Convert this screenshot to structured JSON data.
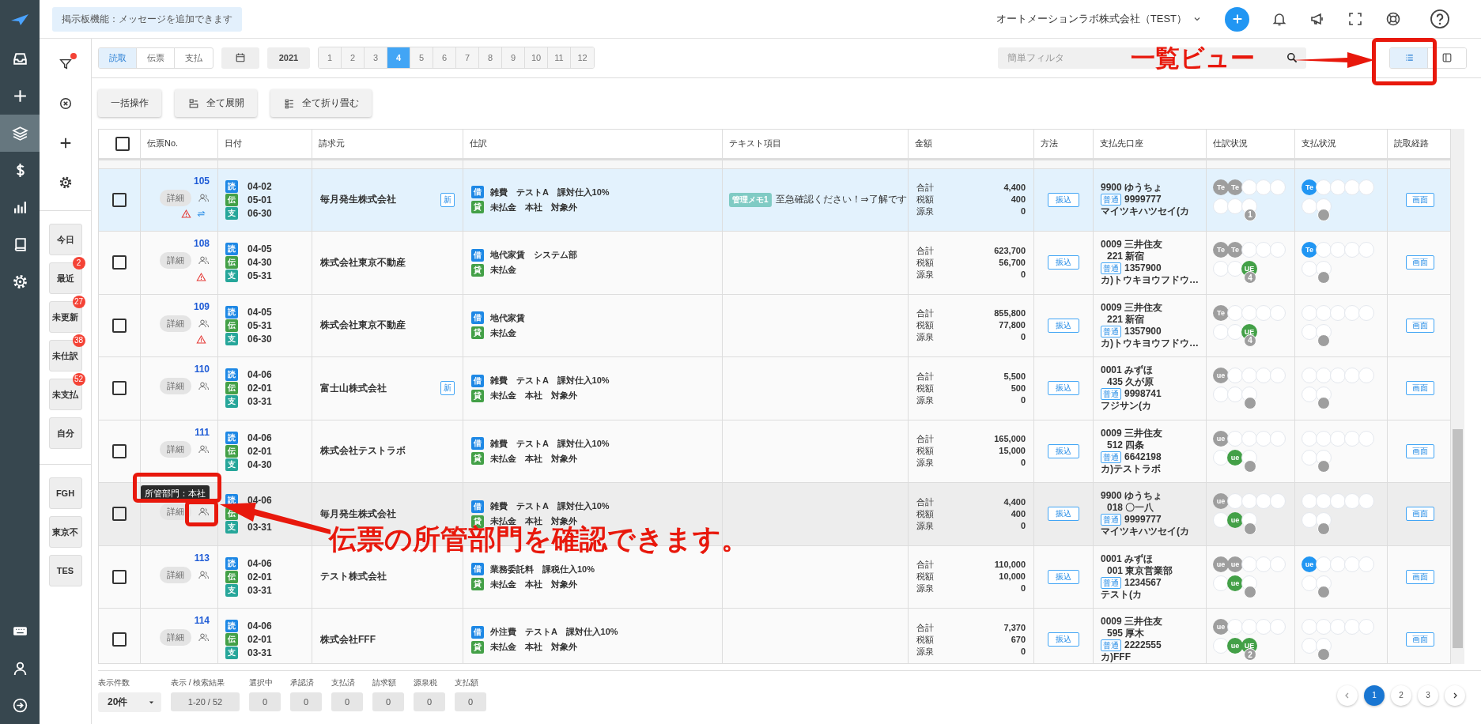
{
  "topbar": {
    "notice": "掲示板機能：メッセージを追加できます",
    "company": "オートメーションラボ株式会社（TEST）",
    "actions": [
      {
        "kind": "add"
      },
      {
        "kind": "bell"
      },
      {
        "kind": "megaphone"
      },
      {
        "kind": "fullscreen"
      },
      {
        "kind": "support"
      },
      {
        "kind": "help"
      }
    ]
  },
  "rail": {
    "items": [
      {
        "kind": "inbox",
        "selected": false
      },
      {
        "kind": "add",
        "selected": false
      },
      {
        "kind": "layers",
        "selected": true
      },
      {
        "kind": "dollar",
        "selected": false
      },
      {
        "kind": "chart",
        "selected": false
      },
      {
        "kind": "book",
        "selected": false
      },
      {
        "kind": "settings",
        "selected": false
      }
    ],
    "bottom": [
      {
        "kind": "keyboard"
      },
      {
        "kind": "person"
      },
      {
        "kind": "logout"
      }
    ]
  },
  "side_panel": {
    "tools": [
      {
        "kind": "filter",
        "alert": true
      },
      {
        "kind": "clear",
        "alert": false
      },
      {
        "kind": "add",
        "alert": false
      },
      {
        "kind": "settings",
        "alert": false
      }
    ],
    "quick_filters": [
      {
        "label": "今日"
      },
      {
        "label": "最近",
        "count": "2"
      },
      {
        "label": "未更新",
        "count": "27"
      },
      {
        "label": "未仕訳",
        "count": "38"
      },
      {
        "label": "未支払",
        "count": "52"
      },
      {
        "label": "自分"
      }
    ],
    "saved_filters": [
      {
        "label": "FGH"
      },
      {
        "label": "東京不"
      },
      {
        "label": "TES"
      }
    ]
  },
  "toolbar": {
    "modes": [
      {
        "label": "読取",
        "selected": true
      },
      {
        "label": "伝票",
        "selected": false
      },
      {
        "label": "支払",
        "selected": false
      }
    ],
    "year": "2021",
    "months": [
      {
        "label": "1",
        "selected": false
      },
      {
        "label": "2",
        "selected": false
      },
      {
        "label": "3",
        "selected": false
      },
      {
        "label": "4",
        "selected": true
      },
      {
        "label": "5",
        "selected": false
      },
      {
        "label": "6",
        "selected": false
      },
      {
        "label": "7",
        "selected": false
      },
      {
        "label": "8",
        "selected": false
      },
      {
        "label": "9",
        "selected": false
      },
      {
        "label": "10",
        "selected": false
      },
      {
        "label": "11",
        "selected": false
      },
      {
        "label": "12",
        "selected": false
      }
    ],
    "search": {
      "placeholder": "簡単フィルタ"
    },
    "views": [
      {
        "kind": "list",
        "selected": true
      },
      {
        "kind": "split",
        "selected": false
      }
    ]
  },
  "actions": [
    {
      "label": "一括操作",
      "kind": "plain"
    },
    {
      "label": "全て展開",
      "kind": "expand"
    },
    {
      "label": "全て折り畳む",
      "kind": "collapse"
    }
  ],
  "table": {
    "all_checked": false,
    "columns": [
      "伝票No.",
      "日付",
      "請求元",
      "仕訳",
      "テキスト項目",
      "金額",
      "方法",
      "支払先口座",
      "仕訳状況",
      "支払状況",
      "読取経路"
    ],
    "rows": [
      {
        "no": "105",
        "checked": false,
        "selected": true,
        "hovered": false,
        "detail": "詳細",
        "warning": true,
        "synced": true,
        "dates": [
          {
            "kind": "read",
            "label": "読",
            "date": "04-02"
          },
          {
            "kind": "slip",
            "label": "伝",
            "date": "05-01"
          },
          {
            "kind": "pay",
            "label": "支",
            "date": "06-30"
          }
        ],
        "vendor": "毎月発生株式会社",
        "new_badge": "新",
        "journal": [
          {
            "kind": "debit",
            "label": "借",
            "text": "雑費　テストA　課対仕入10%"
          },
          {
            "kind": "credit",
            "label": "貸",
            "text": "未払金　本社　対象外"
          }
        ],
        "memo": {
          "tag": "管理メモ1",
          "text": "至急確認ください！⇒了解です"
        },
        "amounts": [
          {
            "label": "合計",
            "value": "4,400"
          },
          {
            "label": "税額",
            "value": "400"
          },
          {
            "label": "源泉",
            "value": "0"
          }
        ],
        "method": "振込",
        "account": {
          "bank": "9900 ゆうちょ",
          "type": "普通",
          "number": "9999777",
          "holder": "マイツキハツセイ(カ"
        },
        "journal_status": {
          "top": [
            {
              "kind": "mark",
              "label": "Te",
              "color": "#9e9e9e"
            },
            {
              "kind": "mark",
              "label": "Te",
              "color": "#9e9e9e"
            },
            {
              "kind": "empty"
            },
            {
              "kind": "empty"
            },
            {
              "kind": "empty"
            }
          ],
          "bottom": [
            {
              "kind": "empty"
            },
            {
              "kind": "empty"
            },
            {
              "kind": "empty"
            }
          ],
          "count": "1"
        },
        "payment_status": {
          "top": [
            {
              "kind": "mark",
              "label": "Te",
              "color": "#2196f3"
            },
            {
              "kind": "empty"
            },
            {
              "kind": "empty"
            },
            {
              "kind": "empty"
            },
            {
              "kind": "empty"
            }
          ],
          "bottom": [
            {
              "kind": "empty"
            },
            {
              "kind": "empty"
            }
          ]
        },
        "route": "画面"
      },
      {
        "no": "108",
        "checked": false,
        "selected": false,
        "hovered": false,
        "detail": "詳細",
        "warning": true,
        "synced": false,
        "dates": [
          {
            "kind": "read",
            "label": "読",
            "date": "04-05"
          },
          {
            "kind": "slip",
            "label": "伝",
            "date": "04-30"
          },
          {
            "kind": "pay",
            "label": "支",
            "date": "05-31"
          }
        ],
        "vendor": "株式会社東京不動産",
        "journal": [
          {
            "kind": "debit",
            "label": "借",
            "text": "地代家賃　システム部"
          },
          {
            "kind": "credit",
            "label": "貸",
            "text": "未払金"
          }
        ],
        "amounts": [
          {
            "label": "合計",
            "value": "623,700"
          },
          {
            "label": "税額",
            "value": "56,700"
          },
          {
            "label": "源泉",
            "value": "0"
          }
        ],
        "method": "振込",
        "account": {
          "bank": "0009 三井住友",
          "branch": "221 新宿",
          "type": "普通",
          "number": "1357900",
          "holder": "カ)トウキヨウフドウ…"
        },
        "journal_status": {
          "top": [
            {
              "kind": "mark",
              "label": "Te",
              "color": "#9e9e9e"
            },
            {
              "kind": "mark",
              "label": "Te",
              "color": "#9e9e9e"
            },
            {
              "kind": "empty"
            },
            {
              "kind": "empty"
            },
            {
              "kind": "empty"
            }
          ],
          "bottom": [
            {
              "kind": "empty"
            },
            {
              "kind": "empty"
            },
            {
              "kind": "mark",
              "label": "UE",
              "color": "#43a047"
            }
          ],
          "count": "4"
        },
        "payment_status": {
          "top": [
            {
              "kind": "mark",
              "label": "Te",
              "color": "#2196f3"
            },
            {
              "kind": "empty"
            },
            {
              "kind": "empty"
            },
            {
              "kind": "empty"
            },
            {
              "kind": "empty"
            }
          ],
          "bottom": [
            {
              "kind": "empty"
            },
            {
              "kind": "empty"
            }
          ]
        },
        "route": "画面"
      },
      {
        "no": "109",
        "checked": false,
        "selected": false,
        "hovered": false,
        "detail": "詳細",
        "warning": true,
        "synced": false,
        "dates": [
          {
            "kind": "read",
            "label": "読",
            "date": "04-05"
          },
          {
            "kind": "slip",
            "label": "伝",
            "date": "05-31"
          },
          {
            "kind": "pay",
            "label": "支",
            "date": "06-30"
          }
        ],
        "vendor": "株式会社東京不動産",
        "journal": [
          {
            "kind": "debit",
            "label": "借",
            "text": "地代家賃"
          },
          {
            "kind": "credit",
            "label": "貸",
            "text": "未払金"
          }
        ],
        "amounts": [
          {
            "label": "合計",
            "value": "855,800"
          },
          {
            "label": "税額",
            "value": "77,800"
          },
          {
            "label": "源泉",
            "value": "0"
          }
        ],
        "method": "振込",
        "account": {
          "bank": "0009 三井住友",
          "branch": "221 新宿",
          "type": "普通",
          "number": "1357900",
          "holder": "カ)トウキヨウフドウ…"
        },
        "journal_status": {
          "top": [
            {
              "kind": "mark",
              "label": "Te",
              "color": "#9e9e9e"
            },
            {
              "kind": "empty"
            },
            {
              "kind": "empty"
            },
            {
              "kind": "empty"
            },
            {
              "kind": "empty"
            }
          ],
          "bottom": [
            {
              "kind": "empty"
            },
            {
              "kind": "empty"
            },
            {
              "kind": "mark",
              "label": "UE",
              "color": "#43a047"
            }
          ],
          "count": "4"
        },
        "payment_status": {
          "top": [
            {
              "kind": "empty"
            },
            {
              "kind": "empty"
            },
            {
              "kind": "empty"
            },
            {
              "kind": "empty"
            },
            {
              "kind": "empty"
            }
          ],
          "bottom": [
            {
              "kind": "empty"
            },
            {
              "kind": "empty"
            }
          ]
        },
        "route": "画面"
      },
      {
        "no": "110",
        "checked": false,
        "selected": false,
        "hovered": false,
        "detail": "詳細",
        "warning": false,
        "synced": false,
        "dates": [
          {
            "kind": "read",
            "label": "読",
            "date": "04-06"
          },
          {
            "kind": "slip",
            "label": "伝",
            "date": "02-01"
          },
          {
            "kind": "pay",
            "label": "支",
            "date": "03-31"
          }
        ],
        "vendor": "富士山株式会社",
        "new_badge": "新",
        "journal": [
          {
            "kind": "debit",
            "label": "借",
            "text": "雑費　テストA　課対仕入10%"
          },
          {
            "kind": "credit",
            "label": "貸",
            "text": "未払金　本社　対象外"
          }
        ],
        "amounts": [
          {
            "label": "合計",
            "value": "5,500"
          },
          {
            "label": "税額",
            "value": "500"
          },
          {
            "label": "源泉",
            "value": "0"
          }
        ],
        "method": "振込",
        "account": {
          "bank": "0001 みずほ",
          "branch": "435 久が原",
          "type": "普通",
          "number": "9998741",
          "holder": "フジサン(カ"
        },
        "journal_status": {
          "top": [
            {
              "kind": "mark",
              "label": "ue",
              "color": "#9e9e9e"
            },
            {
              "kind": "empty"
            },
            {
              "kind": "empty"
            },
            {
              "kind": "empty"
            },
            {
              "kind": "empty"
            }
          ],
          "bottom": [
            {
              "kind": "empty"
            },
            {
              "kind": "empty"
            },
            {
              "kind": "empty"
            }
          ]
        },
        "payment_status": {
          "top": [
            {
              "kind": "empty"
            },
            {
              "kind": "empty"
            },
            {
              "kind": "empty"
            },
            {
              "kind": "empty"
            },
            {
              "kind": "empty"
            }
          ],
          "bottom": [
            {
              "kind": "empty"
            },
            {
              "kind": "empty"
            }
          ]
        },
        "route": "画面"
      },
      {
        "no": "111",
        "checked": false,
        "selected": false,
        "hovered": false,
        "detail": "詳細",
        "warning": false,
        "synced": false,
        "dates": [
          {
            "kind": "read",
            "label": "読",
            "date": "04-06"
          },
          {
            "kind": "slip",
            "label": "伝",
            "date": "02-01"
          },
          {
            "kind": "pay",
            "label": "支",
            "date": "04-30"
          }
        ],
        "vendor": "株式会社テストラボ",
        "journal": [
          {
            "kind": "debit",
            "label": "借",
            "text": "雑費　テストA　課対仕入10%"
          },
          {
            "kind": "credit",
            "label": "貸",
            "text": "未払金　本社　対象外"
          }
        ],
        "amounts": [
          {
            "label": "合計",
            "value": "165,000"
          },
          {
            "label": "税額",
            "value": "15,000"
          },
          {
            "label": "源泉",
            "value": "0"
          }
        ],
        "method": "振込",
        "account": {
          "bank": "0009 三井住友",
          "branch": "512 四条",
          "type": "普通",
          "number": "6642198",
          "holder": "カ)テストラボ"
        },
        "journal_status": {
          "top": [
            {
              "kind": "mark",
              "label": "ue",
              "color": "#9e9e9e"
            },
            {
              "kind": "empty"
            },
            {
              "kind": "empty"
            },
            {
              "kind": "empty"
            },
            {
              "kind": "empty"
            }
          ],
          "bottom": [
            {
              "kind": "empty"
            },
            {
              "kind": "mark",
              "label": "ue",
              "color": "#43a047"
            },
            {
              "kind": "empty"
            }
          ]
        },
        "payment_status": {
          "top": [
            {
              "kind": "empty"
            },
            {
              "kind": "empty"
            },
            {
              "kind": "empty"
            },
            {
              "kind": "empty"
            },
            {
              "kind": "empty"
            }
          ],
          "bottom": [
            {
              "kind": "empty"
            },
            {
              "kind": "empty"
            }
          ]
        },
        "route": "画面"
      },
      {
        "checked": false,
        "selected": false,
        "hovered": true,
        "detail": "詳細",
        "warning": false,
        "synced": false,
        "tooltip": "所管部門：本社",
        "dates": [
          {
            "kind": "read",
            "label": "読",
            "date": "04-06"
          },
          {
            "kind": "slip",
            "label": "伝"
          },
          {
            "kind": "pay",
            "label": "支",
            "date": "03-31"
          }
        ],
        "vendor": "毎月発生株式会社",
        "journal": [
          {
            "kind": "debit",
            "label": "借",
            "text": "雑費　テストA　課対仕入10%"
          },
          {
            "kind": "credit",
            "label": "貸",
            "text": "未払金　本社　対象外"
          }
        ],
        "amounts": [
          {
            "label": "合計",
            "value": "4,400"
          },
          {
            "label": "税額",
            "value": "400"
          },
          {
            "label": "源泉",
            "value": "0"
          }
        ],
        "method": "振込",
        "account": {
          "bank": "9900 ゆうちょ",
          "branch": "018 〇一八",
          "type": "普通",
          "number": "9999777",
          "holder": "マイツキハツセイ(カ"
        },
        "journal_status": {
          "top": [
            {
              "kind": "mark",
              "label": "ue",
              "color": "#9e9e9e"
            },
            {
              "kind": "empty"
            },
            {
              "kind": "empty"
            },
            {
              "kind": "empty"
            },
            {
              "kind": "empty"
            }
          ],
          "bottom": [
            {
              "kind": "empty"
            },
            {
              "kind": "mark",
              "label": "ue",
              "color": "#43a047"
            },
            {
              "kind": "empty"
            }
          ]
        },
        "payment_status": {
          "top": [
            {
              "kind": "empty"
            },
            {
              "kind": "empty"
            },
            {
              "kind": "empty"
            },
            {
              "kind": "empty"
            },
            {
              "kind": "empty"
            }
          ],
          "bottom": [
            {
              "kind": "empty"
            },
            {
              "kind": "empty"
            }
          ]
        },
        "route": "画面"
      },
      {
        "no": "113",
        "checked": false,
        "selected": false,
        "hovered": false,
        "detail": "詳細",
        "warning": false,
        "synced": false,
        "dates": [
          {
            "kind": "read",
            "label": "読",
            "date": "04-06"
          },
          {
            "kind": "slip",
            "label": "伝",
            "date": "02-01"
          },
          {
            "kind": "pay",
            "label": "支",
            "date": "03-31"
          }
        ],
        "vendor": "テスト株式会社",
        "journal": [
          {
            "kind": "debit",
            "label": "借",
            "text": "業務委託料　課税仕入10%"
          },
          {
            "kind": "credit",
            "label": "貸",
            "text": "未払金　本社　対象外"
          }
        ],
        "amounts": [
          {
            "label": "合計",
            "value": "110,000"
          },
          {
            "label": "税額",
            "value": "10,000"
          },
          {
            "label": "源泉",
            "value": "0"
          }
        ],
        "method": "振込",
        "account": {
          "bank": "0001 みずほ",
          "branch": "001 東京営業部",
          "type": "普通",
          "number": "1234567",
          "holder": "テスト(カ"
        },
        "journal_status": {
          "top": [
            {
              "kind": "mark",
              "label": "ue",
              "color": "#9e9e9e"
            },
            {
              "kind": "mark",
              "label": "ue",
              "color": "#9e9e9e"
            },
            {
              "kind": "empty"
            },
            {
              "kind": "empty"
            },
            {
              "kind": "empty"
            }
          ],
          "bottom": [
            {
              "kind": "empty"
            },
            {
              "kind": "mark",
              "label": "ue",
              "color": "#43a047"
            },
            {
              "kind": "empty"
            }
          ]
        },
        "payment_status": {
          "top": [
            {
              "kind": "mark",
              "label": "ue",
              "color": "#2196f3"
            },
            {
              "kind": "empty"
            },
            {
              "kind": "empty"
            },
            {
              "kind": "empty"
            },
            {
              "kind": "empty"
            }
          ],
          "bottom": [
            {
              "kind": "empty"
            },
            {
              "kind": "empty"
            }
          ]
        },
        "route": "画面"
      },
      {
        "no": "114",
        "checked": false,
        "selected": false,
        "hovered": false,
        "detail": "詳細",
        "warning": false,
        "synced": false,
        "dates": [
          {
            "kind": "read",
            "label": "読",
            "date": "04-06"
          },
          {
            "kind": "slip",
            "label": "伝",
            "date": "02-01"
          },
          {
            "kind": "pay",
            "label": "支",
            "date": "03-31"
          }
        ],
        "vendor": "株式会社FFF",
        "journal": [
          {
            "kind": "debit",
            "label": "借",
            "text": "外注費　テストA　課対仕入10%"
          },
          {
            "kind": "credit",
            "label": "貸",
            "text": "未払金　本社　対象外"
          }
        ],
        "amounts": [
          {
            "label": "合計",
            "value": "7,370"
          },
          {
            "label": "税額",
            "value": "670"
          },
          {
            "label": "源泉",
            "value": "0"
          }
        ],
        "method": "振込",
        "account": {
          "bank": "0009 三井住友",
          "branch": "595 厚木",
          "type": "普通",
          "number": "2222555",
          "holder": "カ)FFF"
        },
        "journal_status": {
          "top": [
            {
              "kind": "mark",
              "label": "ue",
              "color": "#9e9e9e"
            },
            {
              "kind": "empty"
            },
            {
              "kind": "empty"
            },
            {
              "kind": "empty"
            },
            {
              "kind": "empty"
            }
          ],
          "bottom": [
            {
              "kind": "empty"
            },
            {
              "kind": "mark",
              "label": "ue",
              "color": "#43a047"
            },
            {
              "kind": "mark",
              "label": "UE",
              "color": "#43a047"
            }
          ],
          "count": "2"
        },
        "payment_status": {
          "top": [
            {
              "kind": "empty"
            },
            {
              "kind": "empty"
            },
            {
              "kind": "empty"
            },
            {
              "kind": "empty"
            },
            {
              "kind": "empty"
            }
          ],
          "bottom": [
            {
              "kind": "empty"
            },
            {
              "kind": "empty"
            }
          ]
        },
        "route": "画面"
      }
    ]
  },
  "footer": {
    "page_size": {
      "label": "表示件数",
      "value": "20件"
    },
    "stats": [
      {
        "label": "表示 / 検索結果",
        "value": "1-20 / 52"
      },
      {
        "label": "選択中",
        "value": "0"
      },
      {
        "label": "承認済",
        "value": "0"
      },
      {
        "label": "支払済",
        "value": "0"
      },
      {
        "label": "請求額",
        "value": "0"
      },
      {
        "label": "源泉税",
        "value": "0"
      },
      {
        "label": "支払額",
        "value": "0"
      }
    ]
  },
  "pagination": {
    "pages": [
      {
        "label": "1",
        "selected": true
      },
      {
        "label": "2",
        "selected": false
      },
      {
        "label": "3",
        "selected": false
      }
    ]
  },
  "annotations": {
    "view_callout": "一覧ビュー",
    "department_callout": "伝票の所管部門を確認できます。"
  }
}
